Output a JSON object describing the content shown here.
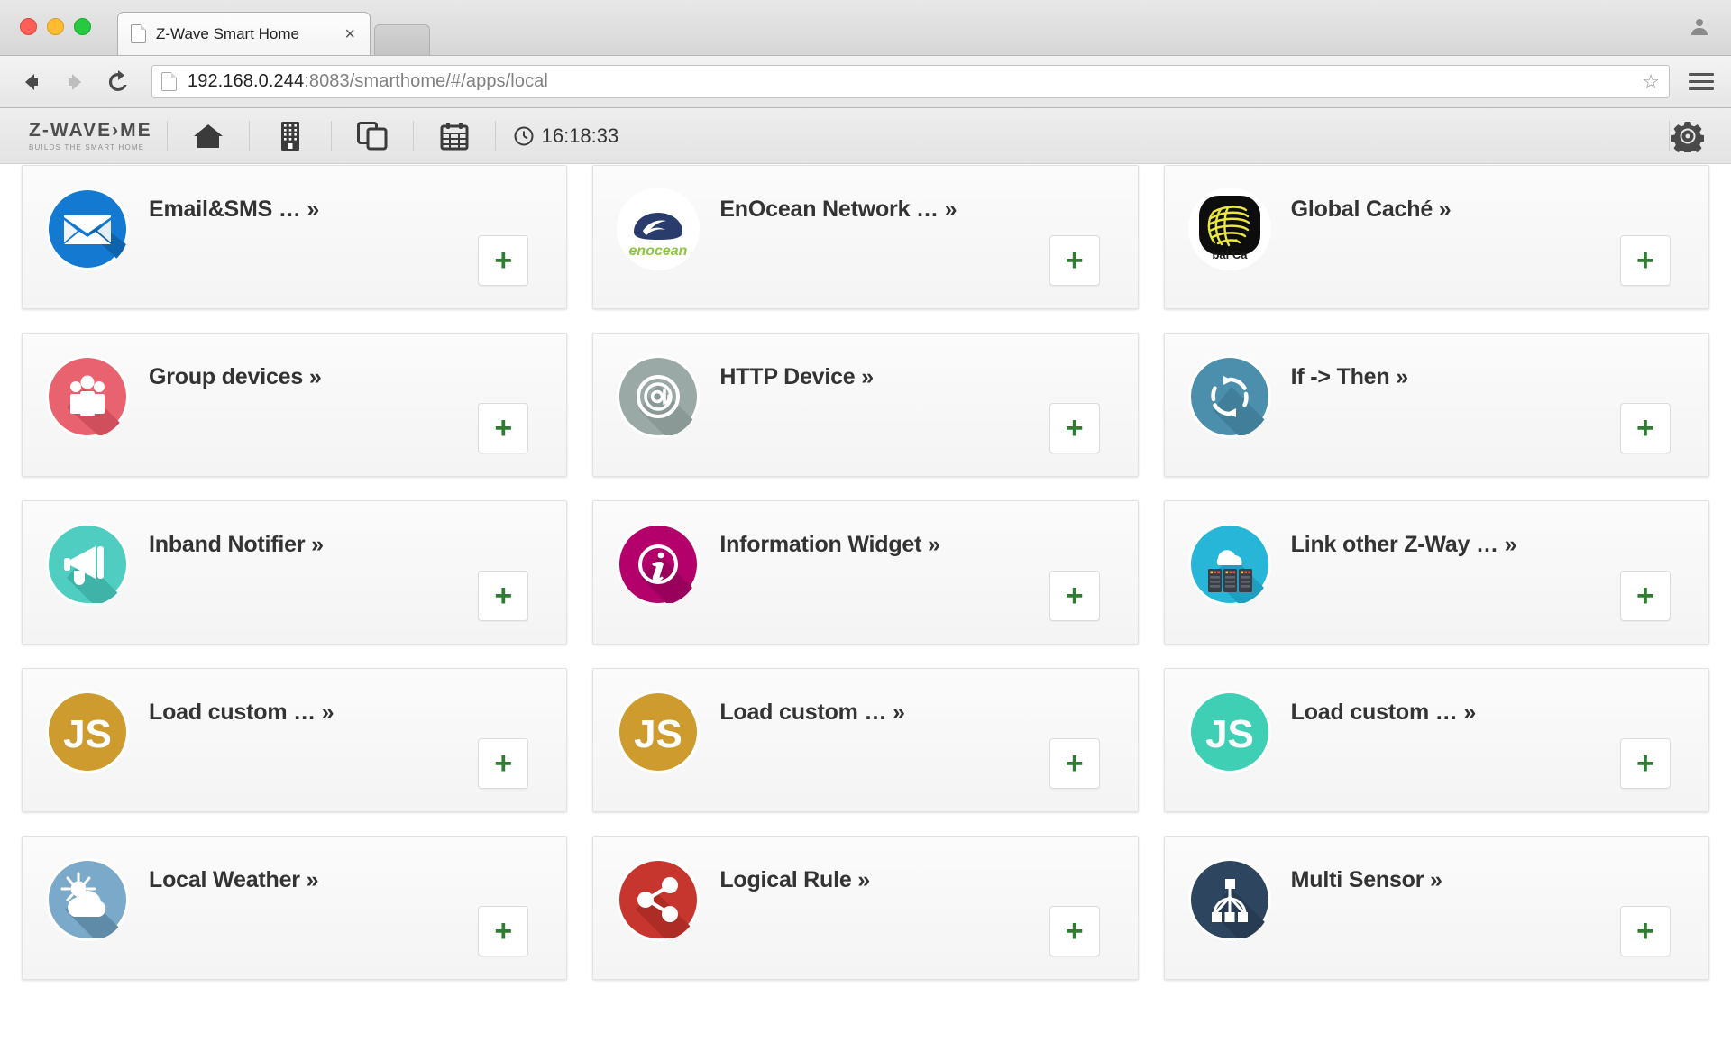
{
  "browser": {
    "tab_title": "Z-Wave Smart Home",
    "tab_close_label": "×",
    "url_host": "192.168.0.244",
    "url_rest": ":8083/smarthome/#/apps/local",
    "back_icon": "back-arrow-icon",
    "forward_icon": "forward-arrow-icon",
    "reload_icon": "reload-icon",
    "star_icon": "☆",
    "menu_icon": "hamburger-menu-icon"
  },
  "app_header": {
    "logo_main": "Z-WAVE›ME",
    "logo_sub": "BUILDS THE SMART HOME",
    "nav": [
      {
        "name": "home",
        "icon": "home-icon"
      },
      {
        "name": "rooms",
        "icon": "building-icon"
      },
      {
        "name": "widgets",
        "icon": "copy-windows-icon"
      },
      {
        "name": "events",
        "icon": "calendar-icon"
      }
    ],
    "clock_icon": "clock-icon",
    "time": "16:18:33",
    "settings_icon": "gear-icon"
  },
  "apps": [
    {
      "title": "Email&SMS … »",
      "icon": "email-sms-icon",
      "add_label": "+"
    },
    {
      "title": "EnOcean Network … »",
      "icon": "enocean-icon",
      "add_label": "+"
    },
    {
      "title": "Global Caché »",
      "icon": "global-cache-icon",
      "add_label": "+"
    },
    {
      "title": "Group devices »",
      "icon": "group-devices-icon",
      "add_label": "+"
    },
    {
      "title": "HTTP Device »",
      "icon": "http-device-icon",
      "add_label": "+"
    },
    {
      "title": "If -> Then »",
      "icon": "if-then-icon",
      "add_label": "+"
    },
    {
      "title": "Inband Notifier »",
      "icon": "inband-notifier-icon",
      "add_label": "+"
    },
    {
      "title": "Information Widget »",
      "icon": "information-widget-icon",
      "add_label": "+"
    },
    {
      "title": "Link other Z-Way … »",
      "icon": "link-zway-icon",
      "add_label": "+"
    },
    {
      "title": "Load custom … »",
      "icon": "js-gold-icon",
      "add_label": "+"
    },
    {
      "title": "Load custom … »",
      "icon": "js-gold-icon",
      "add_label": "+"
    },
    {
      "title": "Load custom … »",
      "icon": "js-teal-icon",
      "add_label": "+"
    },
    {
      "title": "Local Weather »",
      "icon": "local-weather-icon",
      "add_label": "+"
    },
    {
      "title": "Logical Rule »",
      "icon": "logical-rule-icon",
      "add_label": "+"
    },
    {
      "title": "Multi Sensor »",
      "icon": "multi-sensor-icon",
      "add_label": "+"
    }
  ],
  "colors": {
    "email_blue": "#1479d1",
    "enocean_navy": "#2a3c6b",
    "enocean_green": "#8cc63e",
    "global_cache_black": "#0d0d0d",
    "global_cache_yellow": "#e9e63c",
    "group_red": "#e8626f",
    "http_grey": "#9aa9a6",
    "ifthen_blue": "#4b8fac",
    "inband_teal": "#4ecdc0",
    "info_magenta": "#b3006b",
    "link_cyan": "#27b5d8",
    "js_gold": "#cd9b2e",
    "js_teal": "#3fcfb5",
    "weather_blue": "#7ba9c9",
    "logical_red": "#c6362f",
    "sensor_navy": "#2e4560",
    "add_green": "#2f7d32"
  }
}
